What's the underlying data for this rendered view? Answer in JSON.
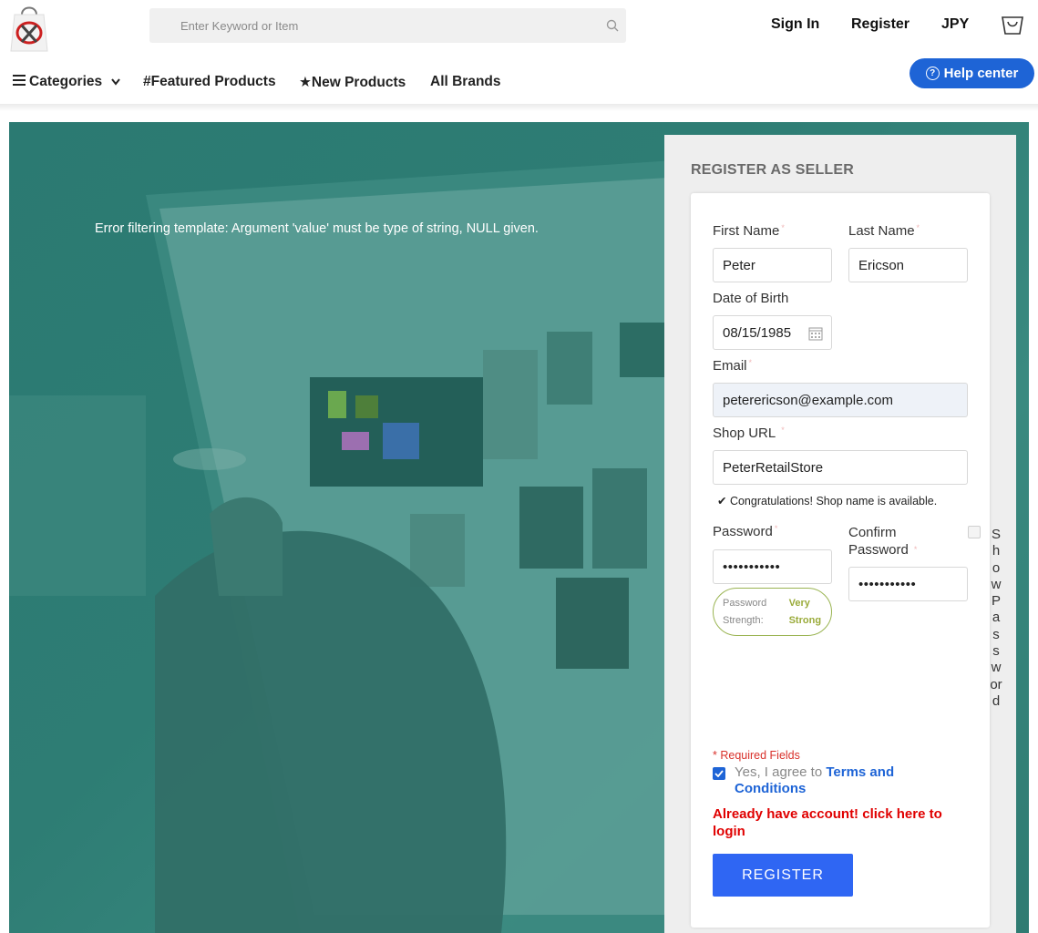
{
  "header": {
    "search_placeholder": "Enter Keyword or Item",
    "sign_in": "Sign In",
    "register": "Register",
    "currency": "JPY"
  },
  "nav": {
    "categories": "Categories",
    "featured": "#Featured Products",
    "new_products": "★New Products",
    "all_brands": "All Brands",
    "help_center": "Help center"
  },
  "hero": {
    "error_message": "Error filtering template: Argument 'value' must be type of string, NULL given."
  },
  "form": {
    "title": "REGISTER AS SELLER",
    "first_name_label": "First Name",
    "first_name_value": "Peter",
    "last_name_label": "Last Name",
    "last_name_value": "Ericson",
    "dob_label": "Date of Birth",
    "dob_value": "08/15/1985",
    "email_label": "Email",
    "email_value": "peterericson@example.com",
    "shop_url_label": "Shop URL",
    "shop_url_value": "PeterRetailStore",
    "shop_available": "✔ Congratulations! Shop name is available.",
    "password_label": "Password",
    "password_value": "•••••••••••",
    "confirm_password_label": "Confirm Password",
    "confirm_password_value": "•••••••••••",
    "show_password_label": "ShowPassword",
    "strength_label": "Password Strength:",
    "strength_value": "Very Strong",
    "required_note": "* Required Fields",
    "agree_prefix": "Yes, I agree to",
    "terms_link": "Terms and Conditions",
    "login_link": "Already have account! click here to login",
    "register_button": "REGISTER"
  },
  "colors": {
    "accent": "#1e64d6",
    "register_button": "#2f66f3",
    "hero_overlay": "#2e7d74",
    "error_red": "#e00000",
    "strength_green": "#9aab3a"
  },
  "icons": [
    "logo-bag-icon",
    "search-icon",
    "cart-icon",
    "menu-icon",
    "chevron-down-icon",
    "help-icon",
    "calendar-icon",
    "checkmark-icon"
  ]
}
